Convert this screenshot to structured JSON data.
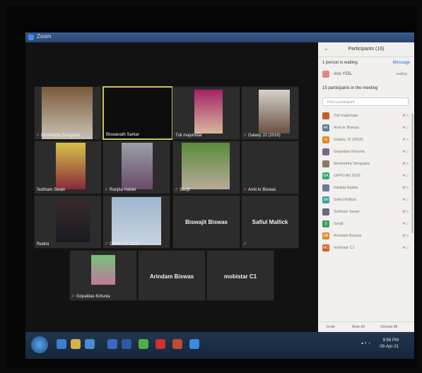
{
  "window": {
    "title": "Zoom"
  },
  "gallery": {
    "tiles": [
      {
        "name": "Monindrita Sengupta",
        "muted": true
      },
      {
        "name": "Biswanath Sarkar",
        "muted": false,
        "active": true
      },
      {
        "name": "Tuli majumdar",
        "muted": false
      },
      {
        "name": "Galaxy J2 (2016)",
        "muted": true
      },
      {
        "name": "Subham Swain",
        "muted": false
      },
      {
        "name": "Ranjita Halder",
        "muted": true
      },
      {
        "name": "Sanjit",
        "muted": true
      },
      {
        "name": "Amit kr Biswas",
        "muted": true
      },
      {
        "name": "Redmi",
        "muted": false
      },
      {
        "name": "OPPO A5 2020",
        "muted": true
      },
      {
        "name": "Biswajit Biswas",
        "muted": false
      },
      {
        "name": "Safiul Mallick",
        "muted": true
      },
      {
        "name": "Gopaldas Kirtunia",
        "muted": true
      },
      {
        "name": "Arindam Biswas",
        "muted": false
      },
      {
        "name": "mobistar C1",
        "muted": false
      }
    ]
  },
  "participants_panel": {
    "title": "Participants (16)",
    "waiting_header": "1 person is waiting",
    "message_button": "Message",
    "waiting": [
      {
        "name": "vivo Y55L",
        "status": "waiting"
      }
    ],
    "in_meeting_header": "15 participants in the meeting",
    "search_placeholder": "Find a participant",
    "list": [
      {
        "initials": "",
        "name": "Tuli majumdar",
        "color": "#c0622e"
      },
      {
        "initials": "AK",
        "name": "Amit kr Biswas",
        "color": "#5a7f9a"
      },
      {
        "initials": "G",
        "name": "Galaxy J2 (2016)",
        "color": "#e08a2a"
      },
      {
        "initials": "",
        "name": "Gopaldas Kirtunia",
        "color": "#7a6a8a"
      },
      {
        "initials": "",
        "name": "Monindrita Sengupta",
        "color": "#8a7a6a"
      },
      {
        "initials": "OA",
        "name": "OPPO A5 2020",
        "color": "#3aa57a"
      },
      {
        "initials": "",
        "name": "Ranjita Halder",
        "color": "#6a7a9a"
      },
      {
        "initials": "SM",
        "name": "Safiul Mallick",
        "color": "#3aa0a0"
      },
      {
        "initials": "",
        "name": "Subham Swain",
        "color": "#6a6a7a"
      },
      {
        "initials": "S",
        "name": "Sanjit",
        "color": "#3aa05a"
      },
      {
        "initials": "AB",
        "name": "Arindam Biswas",
        "color": "#e08a2a"
      },
      {
        "initials": "MC",
        "name": "mobistar C1",
        "color": "#d0602a"
      }
    ],
    "footer": {
      "invite": "Invite",
      "mute_all": "Mute All",
      "unmute_all": "Unmute All"
    }
  },
  "taskbar": {
    "clock_time": "9:56 PM",
    "clock_date": "09-Apr-21"
  }
}
